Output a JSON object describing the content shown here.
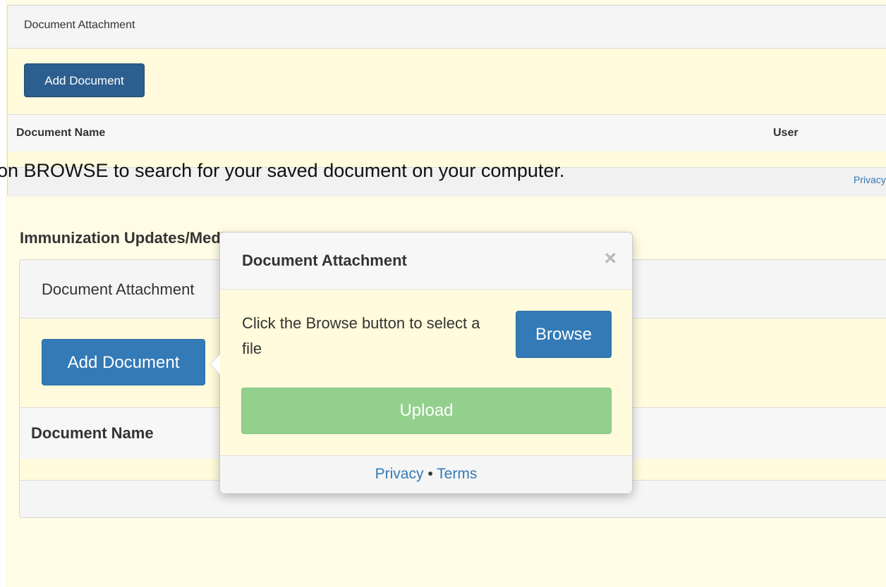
{
  "top_panel": {
    "header_title": "Document Attachment",
    "add_button": "Add Document",
    "col_document_name": "Document Name",
    "col_user": "User",
    "footer_link": "Privacy •"
  },
  "instruction": "on BROWSE to search for your saved document on your computer.",
  "section": {
    "title": "Immunization Updates/Medical Forms",
    "panel_header": "Document Attachment",
    "add_button": "Add Document",
    "col_document_name": "Document Name"
  },
  "popover": {
    "title": "Document Attachment",
    "close": "×",
    "prompt": "Click the Browse button to select a file",
    "browse_button": "Browse",
    "upload_button": "Upload",
    "privacy": "Privacy",
    "separator": "•",
    "terms": "Terms"
  },
  "colors": {
    "background": "#fffde5",
    "primary_button": "#337ab7",
    "upload_button": "#93cf8d"
  }
}
